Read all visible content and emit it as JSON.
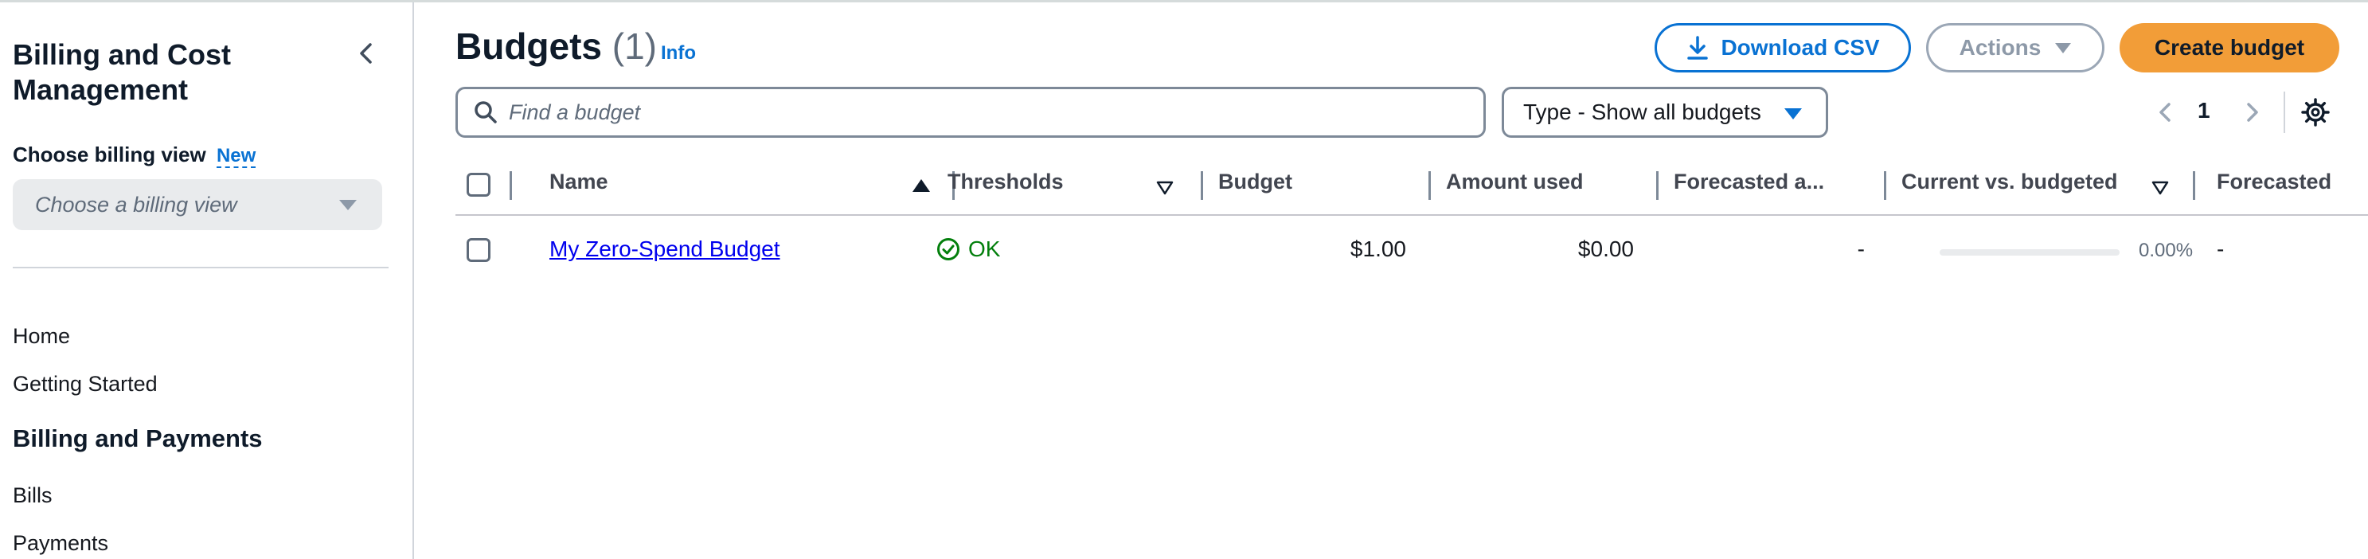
{
  "sidebar": {
    "title": "Billing and Cost Management",
    "billing_view_label": "Choose billing view",
    "billing_view_badge": "New",
    "billing_view_placeholder": "Choose a billing view",
    "nav_items": [
      {
        "label": "Home"
      },
      {
        "label": "Getting Started"
      }
    ],
    "section_title": "Billing and Payments",
    "section_items": [
      {
        "label": "Bills"
      },
      {
        "label": "Payments"
      }
    ]
  },
  "header": {
    "title": "Budgets",
    "count": "(1)",
    "info_link": "Info"
  },
  "toolbar": {
    "download_label": "Download CSV",
    "actions_label": "Actions",
    "create_label": "Create budget",
    "search_placeholder": "Find a budget",
    "filter_label": "Type - Show all budgets",
    "page_number": "1"
  },
  "table": {
    "columns": {
      "name": "Name",
      "thresholds": "Thresholds",
      "budget": "Budget",
      "amount_used": "Amount used",
      "forecasted_amount": "Forecasted a...",
      "current_vs_budgeted": "Current vs. budgeted",
      "forecasted": "Forecasted"
    },
    "rows": [
      {
        "name": "My Zero-Spend Budget",
        "threshold_status": "OK",
        "budget": "$1.00",
        "amount_used": "$0.00",
        "forecasted_amount": "-",
        "current_vs_budgeted_pct": "0.00%",
        "current_vs_budgeted_fraction": 0.0,
        "forecasted": "-"
      }
    ]
  },
  "colors": {
    "link_blue": "#0972d3",
    "primary_orange": "#f29d38",
    "success_green": "#037f0c"
  }
}
